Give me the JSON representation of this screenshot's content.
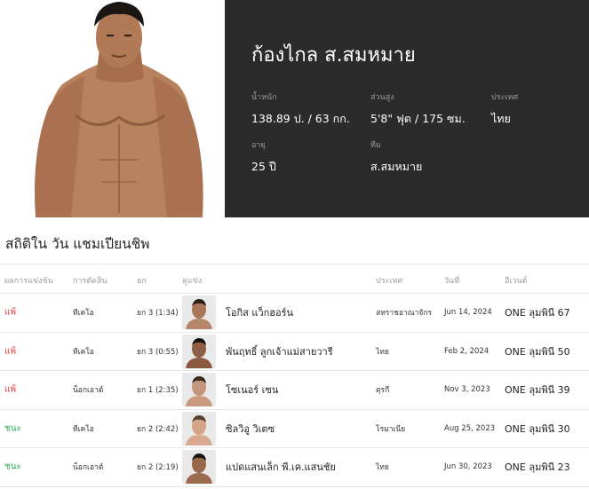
{
  "profile": {
    "name": "ก้องไกล ส.สมหมาย",
    "stats": [
      {
        "label": "น้ำหนัก",
        "value": "138.89 ป. / 63 กก."
      },
      {
        "label": "ส่วนสูง",
        "value": "5'8\" ฟุต / 175 ซม."
      },
      {
        "label": "ประเทศ",
        "value": "ไทย"
      },
      {
        "label": "อายุ",
        "value": "25 ปี"
      },
      {
        "label": "ทีม",
        "value": "ส.สมหมาย"
      }
    ]
  },
  "records": {
    "title": "สถิติใน วัน แชมเปียนชิพ",
    "headers": {
      "result": "ผลการแข่งขัน",
      "method": "การตัดสิน",
      "round": "ยก",
      "opponent": "คู่แข่ง",
      "country": "ประเทศ",
      "date": "วันที่",
      "event": "อีเวนต์"
    },
    "rows": [
      {
        "result": "แพ้",
        "status": "loss",
        "method": "ทีเคโอ",
        "round": "ยก 3 (1:34)",
        "opponent": "โอกิส แว็กฮอร์น",
        "country": "สหราชอาณาจักร",
        "date": "Jun 14, 2024",
        "event": "ONE ลุมพินี 67"
      },
      {
        "result": "แพ้",
        "status": "loss",
        "method": "ทีเคโอ",
        "round": "ยก 3 (0:55)",
        "opponent": "พันฤทธิ์ ลูกเจ้าแม่สายวารี",
        "country": "ไทย",
        "date": "Feb 2, 2024",
        "event": "ONE ลุมพินี 50"
      },
      {
        "result": "แพ้",
        "status": "loss",
        "method": "น็อกเอาต์",
        "round": "ยก 1 (2:35)",
        "opponent": "โซเนอร์ เซน",
        "country": "ตุรกี",
        "date": "Nov 3, 2023",
        "event": "ONE ลุมพินี 39"
      },
      {
        "result": "ชนะ",
        "status": "win",
        "method": "ทีเคโอ",
        "round": "ยก 2 (2:42)",
        "opponent": "ซิลวิอู วิเตซ",
        "country": "โรมาเนีย",
        "date": "Aug 25, 2023",
        "event": "ONE ลุมพินี 30"
      },
      {
        "result": "ชนะ",
        "status": "win",
        "method": "น็อกเอาต์",
        "round": "ยก 2 (2:19)",
        "opponent": "แปดแสนเล็ก พี.เค.แสนชัย",
        "country": "ไทย",
        "date": "Jun 30, 2023",
        "event": "ONE ลุมพินี 23"
      }
    ]
  },
  "colors": {
    "loss": "#e03a3a",
    "win": "#2fa84f",
    "header_bg": "#2b2b2b"
  }
}
